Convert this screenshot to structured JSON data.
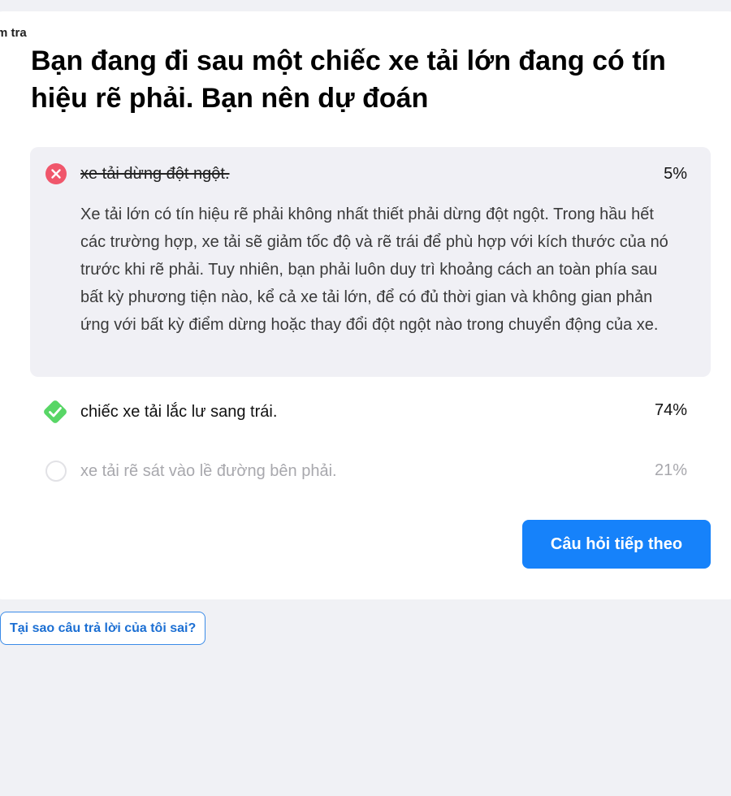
{
  "header": {
    "cut_label": "m tra"
  },
  "question": {
    "text": "Bạn đang đi sau một chiếc xe tải lớn đang có tín hiệu rẽ phải. Bạn nên dự đoán"
  },
  "answers": [
    {
      "text": "xe tải dừng đột ngột.",
      "percent": "5%",
      "state": "wrong-selected",
      "icon": "x-circle-icon",
      "color": "#f0566b",
      "explanation": "Xe tải lớn có tín hiệu rẽ phải không nhất thiết phải dừng đột ngột. Trong hầu hết các trường hợp, xe tải sẽ giảm tốc độ và rẽ trái để phù hợp với kích thước của nó trước khi rẽ phải. Tuy nhiên, bạn phải luôn duy trì khoảng cách an toàn phía sau bất kỳ phương tiện nào, kể cả xe tải lớn, để có đủ thời gian và không gian phản ứng với bất kỳ điểm dừng hoặc thay đổi đột ngột nào trong chuyển động của xe."
    },
    {
      "text": "chiếc xe tải lắc lư sang trái.",
      "percent": "74%",
      "state": "correct",
      "icon": "check-diamond-icon",
      "color": "#58d666"
    },
    {
      "text": "xe tải rẽ sát vào lề đường bên phải.",
      "percent": "21%",
      "state": "unselected",
      "icon": "empty-circle-icon",
      "color": "#e2e2e6"
    }
  ],
  "buttons": {
    "next_label": "Câu hỏi tiếp theo",
    "why_label": "Tại sao câu trả lời của tôi sai?",
    "accent": "#1682fa"
  }
}
